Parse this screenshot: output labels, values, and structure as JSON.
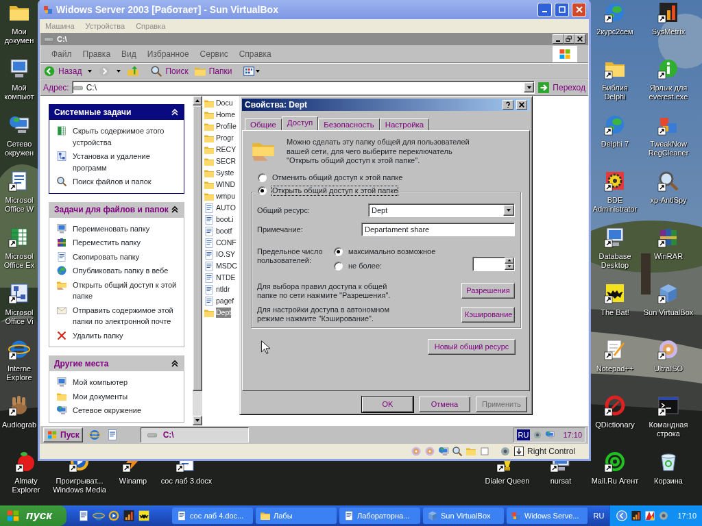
{
  "desktop": {
    "left_column": [
      {
        "label": "Мои докумен"
      },
      {
        "label": "Мой компьют"
      },
      {
        "label": "Сетево окружен"
      },
      {
        "label": "Microsol Office W"
      },
      {
        "label": "Microsol Office Ex"
      },
      {
        "label": "Microsol Office Vi"
      },
      {
        "label": "Interne Explore"
      },
      {
        "label": "Audiograb"
      },
      {
        "label": "Almaty Explorer"
      }
    ],
    "bottom_row": [
      {
        "label": "Проигрыват... Windows Media"
      },
      {
        "label": "Winamp"
      },
      {
        "label": "сос лаб 3.docx"
      },
      {
        "label": "Dialer Queen"
      },
      {
        "label": "nursat"
      }
    ],
    "right_column_1": [
      {
        "label": "2курс2сем"
      },
      {
        "label": "Библия Delphi"
      },
      {
        "label": "Delphi 7"
      },
      {
        "label": "BDE Administrator"
      },
      {
        "label": "Database Desktop"
      },
      {
        "label": "The Bat!"
      },
      {
        "label": "Notepad++"
      },
      {
        "label": "QDictionary"
      },
      {
        "label": "Mail.Ru Агент"
      }
    ],
    "right_column_2": [
      {
        "label": "SysMetrix"
      },
      {
        "label": "Ярлык для everest.exe"
      },
      {
        "label": "TweakNow RegCleaner"
      },
      {
        "label": "xp-AntiSpy"
      },
      {
        "label": "WinRAR"
      },
      {
        "label": "Sun VirtualBox"
      },
      {
        "label": "UltraISO"
      },
      {
        "label": "Командная строка"
      },
      {
        "label": "Корзина"
      }
    ]
  },
  "vbox": {
    "title": "Widows Server 2003 [Работает] - Sun VirtualBox",
    "menu": [
      "Машина",
      "Устройства",
      "Справка"
    ],
    "host_key": "Right Control"
  },
  "explorer": {
    "title": "C:\\",
    "menu": [
      "Файл",
      "Правка",
      "Вид",
      "Избранное",
      "Сервис",
      "Справка"
    ],
    "back": "Назад",
    "search": "Поиск",
    "folders": "Папки",
    "address_label": "Адрес:",
    "address": "C:\\",
    "go": "Переход",
    "task_panels": [
      {
        "title": "Системные задачи",
        "kind": "special",
        "items": [
          "Скрыть содержимое этого устройства",
          "Установка и удаление программ",
          "Поиск файлов и папок"
        ]
      },
      {
        "title": "Задачи для файлов и папок",
        "kind": "normal",
        "items": [
          "Переименовать папку",
          "Переместить папку",
          "Скопировать папку",
          "Опубликовать папку в вебе",
          "Открыть общий доступ к этой папке",
          "Отправить содержимое этой папки по электронной почте",
          "Удалить папку"
        ]
      },
      {
        "title": "Другие места",
        "kind": "normal",
        "items": [
          "Мой компьютер",
          "Мои документы",
          "Сетевое окружение"
        ]
      }
    ],
    "files": [
      {
        "name": "Docu",
        "selected": false
      },
      {
        "name": "Home",
        "selected": false
      },
      {
        "name": "Profile",
        "selected": false
      },
      {
        "name": "Progr",
        "selected": false
      },
      {
        "name": "RECY",
        "selected": false
      },
      {
        "name": "SECR",
        "selected": false
      },
      {
        "name": "Syste",
        "selected": false
      },
      {
        "name": "WIND",
        "selected": false
      },
      {
        "name": "wmpu",
        "selected": false
      },
      {
        "name": "AUTO",
        "selected": false
      },
      {
        "name": "boot.i",
        "selected": false
      },
      {
        "name": "bootf",
        "selected": false
      },
      {
        "name": "CONF",
        "selected": false
      },
      {
        "name": "IO.SY",
        "selected": false
      },
      {
        "name": "MSDC",
        "selected": false
      },
      {
        "name": "NTDE",
        "selected": false
      },
      {
        "name": "ntldr",
        "selected": false
      },
      {
        "name": "pagef",
        "selected": false
      },
      {
        "name": "Dept",
        "selected": true
      }
    ]
  },
  "dialog": {
    "title": "Свойства: Dept",
    "tabs": [
      {
        "label": "Общие",
        "selected": false
      },
      {
        "label": "Доступ",
        "selected": true
      },
      {
        "label": "Безопасность",
        "selected": false
      },
      {
        "label": "Настройка",
        "selected": false
      }
    ],
    "intro": "Можно сделать эту папку общей для пользователей вашей сети, для чего выберите переключатель \"Открыть общий доступ к этой папке\".",
    "share_options": [
      {
        "label": "Отменить общий доступ к этой папке",
        "selected": false
      },
      {
        "label": "Открыть общий доступ к этой папке",
        "selected": true
      }
    ],
    "share_name_label": "Общий ресурс:",
    "share_name": "Dept",
    "comment_label": "Примечание:",
    "comment": "Departament share",
    "limit_label": "Предельное число пользователей:",
    "limit_options": [
      {
        "label": "максимально возможное",
        "selected": true
      },
      {
        "label": "не более:",
        "selected": false
      }
    ],
    "permissions_text": "Для выбора правил доступа к общей папке по сети нажмите \"Разрешения\".",
    "permissions_button": "Разрешения",
    "caching_text": "Для настройки доступа в автономном режиме нажмите \"Кэширование\".",
    "caching_button": "Кэширование",
    "new_share_button": "Новый общий ресурс",
    "buttons": [
      {
        "label": "OK",
        "disabled": false
      },
      {
        "label": "Отмена",
        "disabled": false
      },
      {
        "label": "Применить",
        "disabled": true
      }
    ]
  },
  "guest_taskbar": {
    "start": "Пуск",
    "task": "C:\\",
    "lang": "RU",
    "clock": "17:10"
  },
  "taskbar": {
    "start": "пуск",
    "tasks": [
      "сос лаб 4.doc...",
      "Лабы",
      "Лабораторна...",
      "Sun VirtualBox",
      "Widows Serve..."
    ],
    "lang": "RU",
    "clock": "17:10"
  }
}
